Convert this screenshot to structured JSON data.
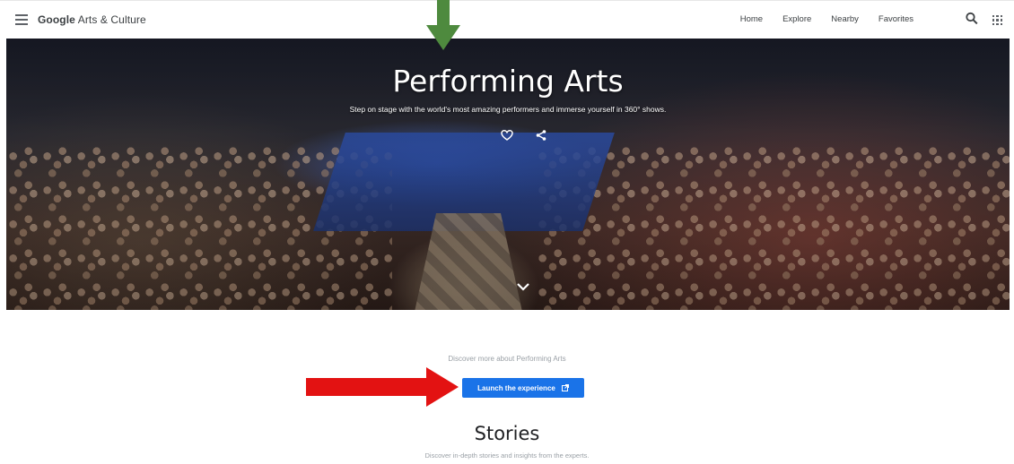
{
  "header": {
    "brand_bold": "Google",
    "brand_rest": " Arts & Culture",
    "nav": [
      "Home",
      "Explore",
      "Nearby",
      "Favorites"
    ],
    "icons": [
      "menu-icon",
      "search-icon",
      "apps-grid-icon"
    ]
  },
  "hero": {
    "title": "Performing Arts",
    "subtitle": "Step on stage with the world's most amazing performers and immerse yourself in 360° shows.",
    "actions": [
      "heart-icon",
      "share-icon"
    ],
    "scroll_icon": "chevron-down-icon"
  },
  "main": {
    "discover_text": "Discover more about Performing Arts",
    "launch_label": "Launch the experience",
    "launch_icon": "external-link-icon",
    "stories_title": "Stories",
    "stories_subtitle": "Discover in-depth stories and insights from the experts."
  },
  "annotations": {
    "down_arrow_color": "#4e8a3e",
    "right_arrow_color": "#e31212"
  },
  "colors": {
    "accent": "#1a73e8"
  }
}
